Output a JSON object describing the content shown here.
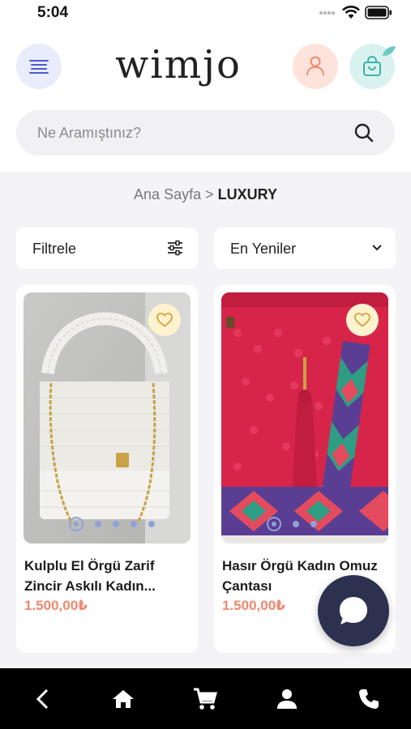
{
  "status_bar": {
    "time": "5:04"
  },
  "header": {
    "logo": "wimjo"
  },
  "search": {
    "placeholder": "Ne Aramıştınız?"
  },
  "breadcrumb": {
    "home": "Ana Sayfa",
    "separator": ">",
    "current": "LUXURY"
  },
  "toolbar": {
    "filter_label": "Filtrele",
    "sort_label": "En Yeniler"
  },
  "products": [
    {
      "title": "Kulplu El Örgü Zarif Zincir Askılı Kadın...",
      "price": "1.500,00₺",
      "image_colors": [
        "white knitted handbag",
        "gold chain"
      ]
    },
    {
      "title": "Hasır Örgü Kadın Omuz Çantası",
      "price": "1.500,00₺",
      "image_colors": [
        "red crochet bag",
        "patterned strap"
      ]
    }
  ],
  "colors": {
    "accent": "#f2876e",
    "fab": "#2c3150",
    "menu_bg": "#e9ecfb",
    "user_bg": "#fde3dc",
    "cart_bg": "#d9f2f0",
    "fav_bg": "#fff3cf"
  },
  "icons": [
    "menu-icon",
    "user-icon",
    "cart-icon",
    "search-icon",
    "filter-icon",
    "chevron-down-icon",
    "heart-icon",
    "chat-icon",
    "back-icon",
    "home-icon",
    "cart-icon",
    "profile-icon",
    "phone-icon"
  ]
}
